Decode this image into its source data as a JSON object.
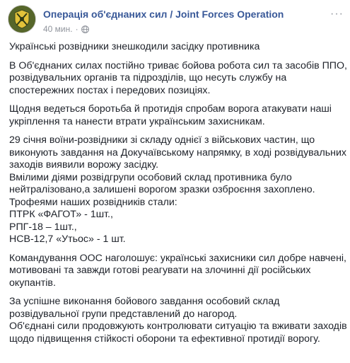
{
  "header": {
    "page_name": "Операція об'єднаних сил / Joint Forces Operation",
    "time": "40 мин.",
    "separator": "·",
    "privacy_icon": "globe-icon",
    "more_label": "···",
    "avatar_icon": "military-emblem-icon"
  },
  "post": {
    "paragraphs": [
      [
        "Українські розвідники знешкодили засідку противника"
      ],
      [
        "В Об'єднаних силах постійно триває бойова робота сил та засобів ППО,",
        "розвідувальних органів та підрозділів, що несуть службу на",
        "спостережних постах і передових позиціях."
      ],
      [
        "Щодня ведеться боротьба й протидія спробам ворога атакувати наші",
        "укріплення та нанести втрати українським захисникам."
      ],
      [
        "29 січня воїни-розвідники зі складу однієї з військових частин, що",
        "виконують завдання на Докучаївському напрямку, в ході розвідувальних",
        "заходів виявили ворожу засідку.",
        "Вмілими діями розвідгрупи особовий склад противника було",
        "нейтралізовано,а залишені ворогом зразки озброєння захоплено.",
        "Трофеями наших розвідників стали:",
        "ПТРК «ФАГОТ» - 1шт.,",
        "РПГ-18 – 1шт.,",
        "НСВ-12,7 «Утьос» - 1 шт."
      ],
      [
        "Командування ООС наголошує: українські захисники сил добре навчені,",
        "мотивовані та завжди готові реагувати на злочинні дії російських",
        "окупантів."
      ],
      [
        "За успішне виконання бойового завдання особовий склад",
        "розвідувальної групи представлений до нагород.",
        "Об'єднані сили продовжують контролювати ситуацію та вживати заходів",
        "щодо підвищення стійкості оборони та ефективної протидії ворогу."
      ]
    ]
  },
  "colors": {
    "link": "#385898",
    "meta": "#90949c",
    "text": "#1d2129",
    "avatar_bg": "#5a6a2c"
  }
}
